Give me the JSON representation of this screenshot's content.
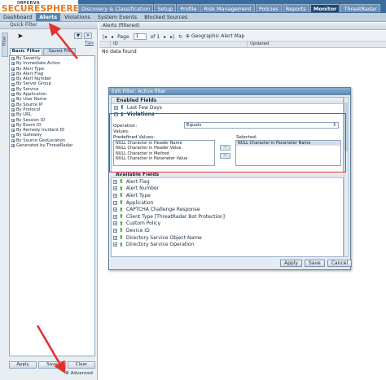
{
  "logo": {
    "small": "IMPERVA",
    "big": "SECURESPHERE"
  },
  "top_nav": [
    "Discovery & Classification",
    "Setup",
    "Profile",
    "Risk Management",
    "Policies",
    "Reports",
    "Monitor",
    "ThreatRadar"
  ],
  "sub_nav": [
    "Dashboard",
    "Alerts",
    "Violations",
    "System Events",
    "Blocked Sources"
  ],
  "left": {
    "title": "Quick Filter",
    "side_tab": "Filter",
    "tips": "Tips",
    "tabs": [
      "Basic Filter",
      "Saved Filt"
    ],
    "filters": [
      "By Severity",
      "By Immediate Action",
      "By Alert Type",
      "By Alert Flag",
      "By Alert Number",
      "By Server Group",
      "By Service",
      "By Application",
      "By User Name",
      "By Source IP",
      "By Protocol",
      "By URL",
      "By Session ID",
      "By Event ID",
      "By Remedy Incident ID",
      "By Gateway",
      "By Source GeoLocation",
      "Generated by ThreatRadar"
    ],
    "buttons": {
      "apply": "Apply",
      "save": "Save",
      "clear": "Clear"
    },
    "advanced": "Advanced"
  },
  "main": {
    "title": "Alerts (filtered)",
    "pager": {
      "page_label": "Page",
      "page_value": "1",
      "of_label": "of 1"
    },
    "geo_link": "Geographic Alert Map",
    "columns": [
      "ID",
      "Updated"
    ],
    "no_data": "No data found"
  },
  "dialog": {
    "title": "Edit Filter: Active filter",
    "enabled_header": "Enabled Fields",
    "last_few_days": "Last Few Days",
    "violations": "Violations",
    "operation_label": "Operation:",
    "operation_value": "Equals",
    "values_label": "Values:",
    "predefined_label": "Predefined Values:",
    "selected_label": "Selected:",
    "predefined_values": [
      "NULL Character in Header Name",
      "NULL Character in Header Value",
      "NULL Character in Method",
      "NULL Character in Parameter Value"
    ],
    "selected_values": [
      "NULL Character in Parameter Name"
    ],
    "available_header": "Available Fields",
    "available_fields": [
      "Alert Flag",
      "Alert Number",
      "Alert Type",
      "Application",
      "CAPTCHA Challenge Response",
      "Client Type [ThreatRadar Bot Protection]",
      "Custom Policy",
      "Device ID",
      "Directory Service Object Name",
      "Directory Service Operation"
    ],
    "buttons": {
      "apply": "Apply",
      "save": "Save",
      "cancel": "Cancel"
    }
  }
}
